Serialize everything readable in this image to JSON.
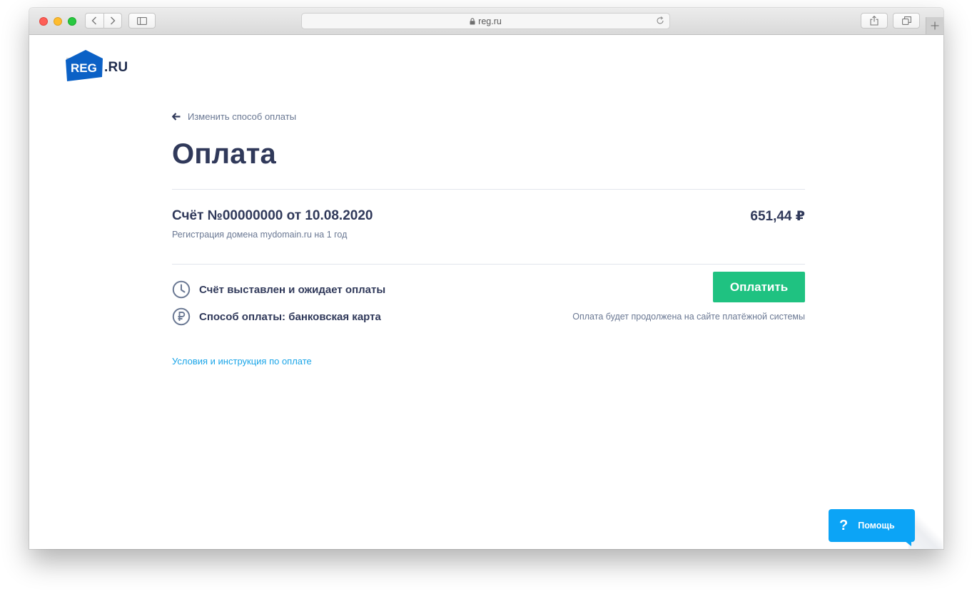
{
  "browser": {
    "url": "reg.ru"
  },
  "logo": {
    "brand": "REG",
    "suffix": ".RU"
  },
  "back_link": {
    "label": "Изменить способ оплаты"
  },
  "page": {
    "title": "Оплата"
  },
  "invoice": {
    "title": "Счёт №00000000 от 10.08.2020",
    "description": "Регистрация домена mydomain.ru на 1 год",
    "amount": "651,44 ₽"
  },
  "status": {
    "state": "Счёт выставлен и ожидает оплаты",
    "method": "Способ оплаты: банковская карта"
  },
  "payment": {
    "button_label": "Оплатить",
    "note": "Оплата будет продолжена на сайте платёжной системы"
  },
  "terms_link": {
    "label": "Условия и инструкция по оплате"
  },
  "help": {
    "icon_glyph": "?",
    "label": "Помощь"
  },
  "colors": {
    "brand_blue": "#0b61c6",
    "heading": "#30395a",
    "muted": "#6a7893",
    "pay_green": "#1fc281",
    "link_blue": "#1aa5e8",
    "help_blue": "#0ca4f6"
  }
}
